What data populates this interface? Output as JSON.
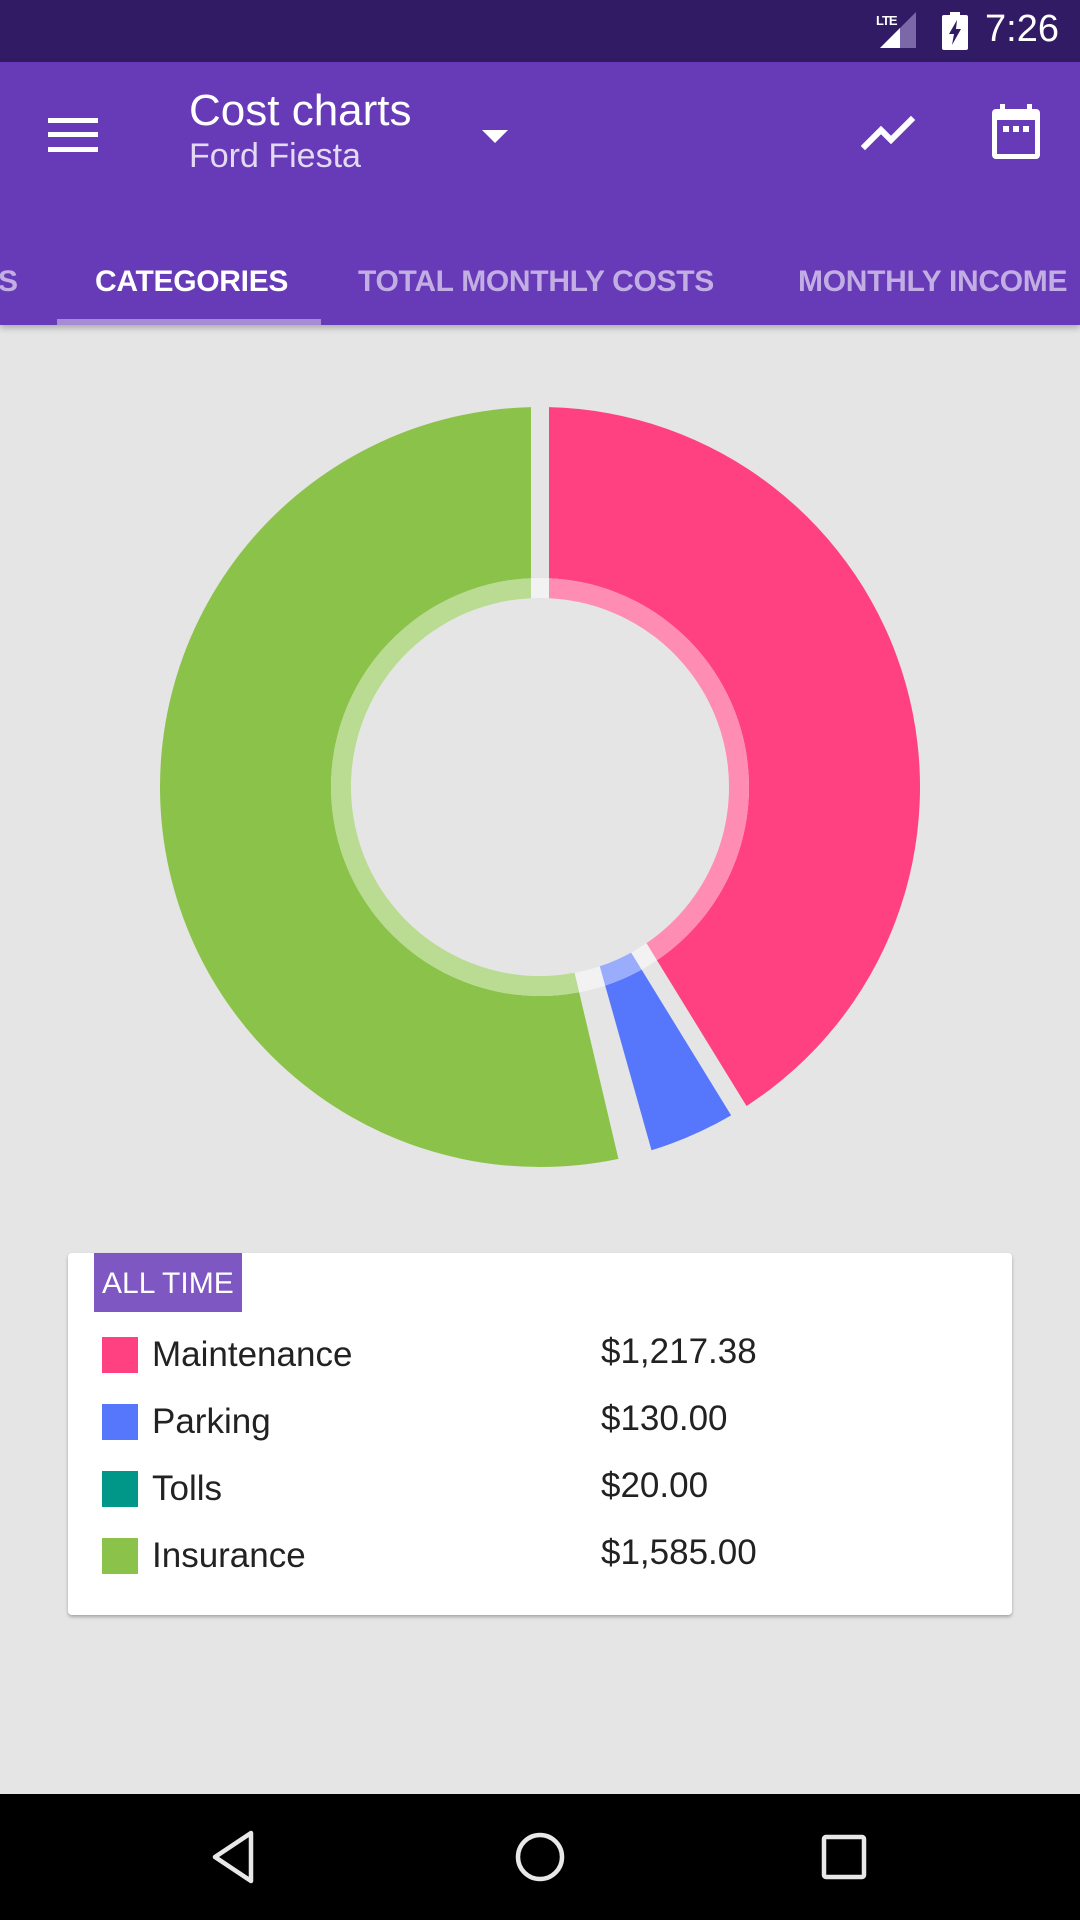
{
  "status_bar": {
    "network": "LTE",
    "time": "7:26",
    "icons": [
      "signal-icon",
      "battery-charging-icon"
    ]
  },
  "app_bar": {
    "title": "Cost charts",
    "subtitle": "Ford Fiesta",
    "icons": {
      "menu": "hamburger-menu-icon",
      "dropdown": "dropdown-arrow-icon",
      "trend": "trending-chart-icon",
      "calendar": "calendar-icon"
    }
  },
  "tabs": [
    {
      "label": "S",
      "active": false
    },
    {
      "label": "CATEGORIES",
      "active": true
    },
    {
      "label": "TOTAL MONTHLY COSTS",
      "active": false
    },
    {
      "label": "MONTHLY INCOME",
      "active": false
    }
  ],
  "colors": {
    "primary": "#673AB7",
    "primary_dark": "#311B64",
    "badge": "#7E57C2",
    "maintenance": "#FF4081",
    "parking": "#5677FC",
    "tolls": "#009688",
    "insurance": "#8BC34A"
  },
  "legend": {
    "period_label": "ALL TIME",
    "items": [
      {
        "label": "Maintenance",
        "value": "$1,217.38",
        "color": "#FF4081"
      },
      {
        "label": "Parking",
        "value": "$130.00",
        "color": "#5677FC"
      },
      {
        "label": "Tolls",
        "value": "$20.00",
        "color": "#009688"
      },
      {
        "label": "Insurance",
        "value": "$1,585.00",
        "color": "#8BC34A"
      }
    ]
  },
  "chart_data": {
    "type": "pie",
    "title": "",
    "style": "donut",
    "start_angle": "top, clockwise",
    "categories": [
      "Maintenance",
      "Parking",
      "Tolls",
      "Insurance"
    ],
    "values": [
      1217.38,
      130.0,
      20.0,
      1585.0
    ],
    "colors": [
      "#FF4081",
      "#5677FC",
      "#009688",
      "#8BC34A"
    ],
    "legend_position": "below"
  },
  "nav_bar": {
    "icons": [
      "back-icon",
      "home-icon",
      "recents-icon"
    ]
  }
}
